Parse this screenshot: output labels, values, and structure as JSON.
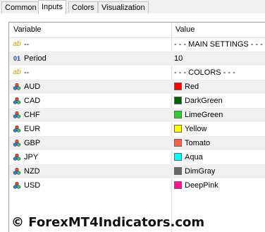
{
  "tabs": [
    {
      "label": "Common"
    },
    {
      "label": "Inputs"
    },
    {
      "label": "Colors"
    },
    {
      "label": "Visualization"
    }
  ],
  "table": {
    "col_variable": "Variable",
    "col_value": "Value",
    "rows": [
      {
        "icon": "ab",
        "variable": "--",
        "value": "- - - MAIN SETTINGS - - -"
      },
      {
        "icon": "01",
        "variable": "Period",
        "value": "10"
      },
      {
        "icon": "ab",
        "variable": "--",
        "value": "- - - COLORS - - -"
      },
      {
        "icon": "palette",
        "variable": "AUD",
        "value": "Red",
        "color": "#ff0000"
      },
      {
        "icon": "palette",
        "variable": "CAD",
        "value": "DarkGreen",
        "color": "#006400"
      },
      {
        "icon": "palette",
        "variable": "CHF",
        "value": "LimeGreen",
        "color": "#32cd32"
      },
      {
        "icon": "palette",
        "variable": "EUR",
        "value": "Yellow",
        "color": "#ffff00"
      },
      {
        "icon": "palette",
        "variable": "GBP",
        "value": "Tomato",
        "color": "#ff6347"
      },
      {
        "icon": "palette",
        "variable": "JPY",
        "value": "Aqua",
        "color": "#00ffff"
      },
      {
        "icon": "palette",
        "variable": "NZD",
        "value": "DimGray",
        "color": "#696969"
      },
      {
        "icon": "palette",
        "variable": "USD",
        "value": "DeepPink",
        "color": "#ff1493"
      }
    ]
  },
  "watermark": "© ForexMT4Indicators.com"
}
